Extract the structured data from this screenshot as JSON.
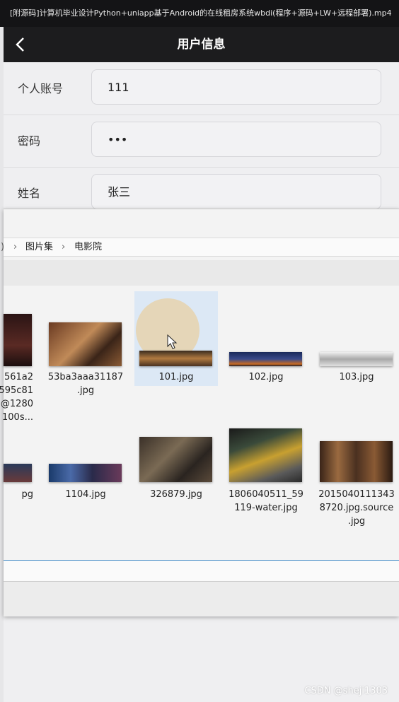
{
  "video": {
    "title": "[附源码]计算机毕业设计Python+uniapp基于Android的在线租房系统wbdi(程序+源码+LW+远程部署).mp4"
  },
  "navbar": {
    "title": "用户信息"
  },
  "form": {
    "rows": [
      {
        "label": "个人账号",
        "value": "111"
      },
      {
        "label": "密码",
        "value": "•••"
      },
      {
        "label": "姓名",
        "value": "张三"
      }
    ]
  },
  "dialog": {
    "breadcrumb": [
      "图片集",
      "电影院"
    ],
    "files": [
      {
        "name": "561a2\n595c81\n@1280\n100s..."
      },
      {
        "name": "53ba3aaa31187\n.jpg"
      },
      {
        "name": "101.jpg"
      },
      {
        "name": "102.jpg"
      },
      {
        "name": "103.jpg"
      },
      {
        "name": "pg"
      },
      {
        "name": "1104.jpg"
      },
      {
        "name": "326879.jpg"
      },
      {
        "name": "1806040511_59\n119-water.jpg"
      },
      {
        "name": "2015040111343\n8720.jpg.source\n.jpg"
      }
    ],
    "selected_file": "101.jpg"
  },
  "watermark": "CSDN @sheji1303"
}
